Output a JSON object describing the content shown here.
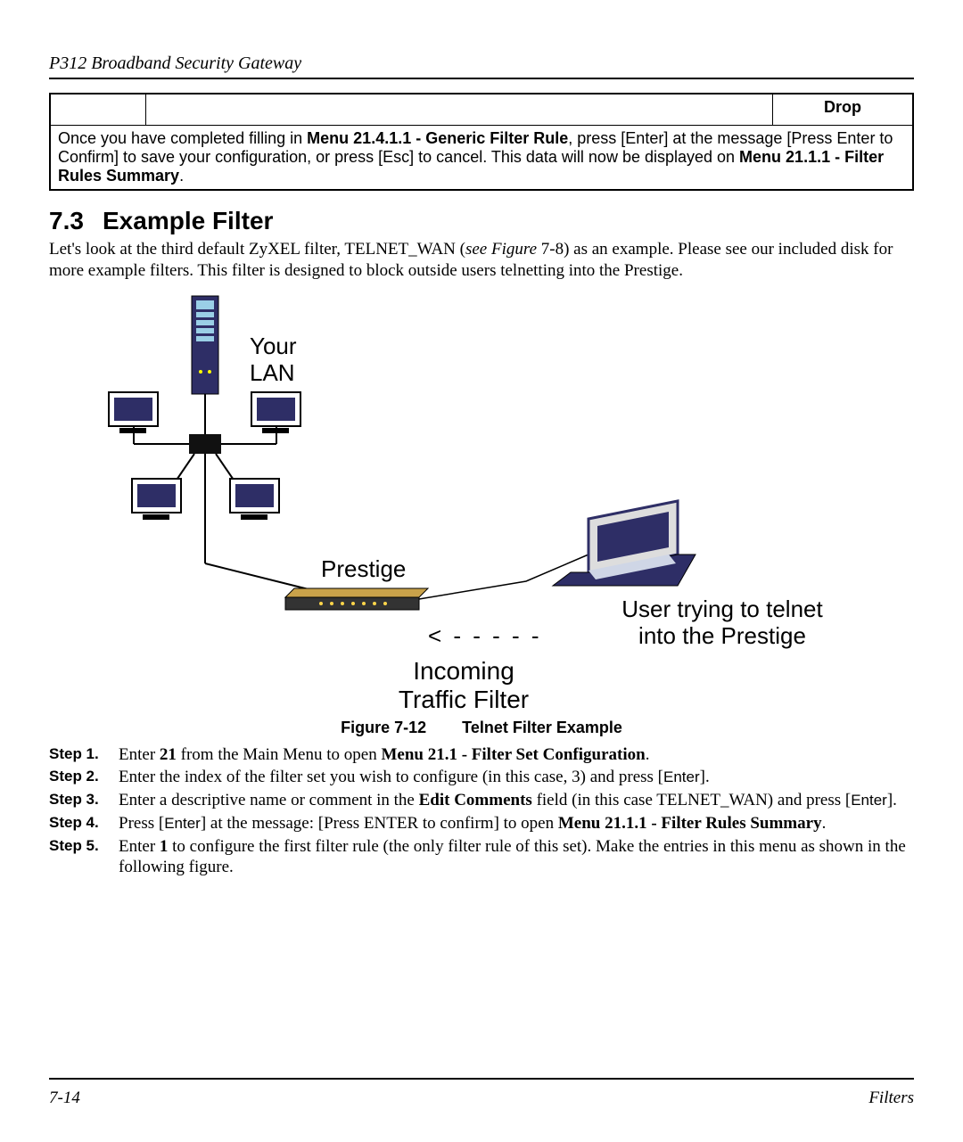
{
  "header": {
    "running": "P312  Broadband Security Gateway"
  },
  "table": {
    "drop_label": "Drop",
    "note_prefix": "Once you have completed filling in ",
    "note_bold1": "Menu 21.4.1.1 - Generic Filter Rule",
    "note_mid": ", press [Enter] at the message [Press Enter to Confirm] to save your configuration, or press [Esc] to cancel. This data will now be displayed on ",
    "note_bold2": "Menu 21.1.1 - Filter Rules Summary",
    "note_end": "."
  },
  "section": {
    "number": "7.3",
    "title": "Example Filter",
    "para_a": "Let's look at the third default ZyXEL filter, TELNET_WAN (",
    "para_italic": "see Figure ",
    "para_b": "7-8) as an example. Please see our included disk for more example filters. This filter is designed to block outside users telnetting into the Prestige."
  },
  "diagram": {
    "lan_label_1": "Your",
    "lan_label_2": "LAN",
    "prestige_label": "Prestige",
    "incoming_1": "Incoming",
    "incoming_2": "Traffic Filter",
    "arrow": "< - - - - -",
    "user_line1": "User trying to telnet",
    "user_line2": "into the Prestige"
  },
  "figure_caption": {
    "label": "Figure 7-12",
    "title": "Telnet Filter Example"
  },
  "steps": [
    {
      "label": "Step 1.",
      "parts": [
        {
          "t": "Enter "
        },
        {
          "t": "21",
          "b": true
        },
        {
          "t": " from the Main Menu to open "
        },
        {
          "t": "Menu 21.1 - Filter Set Configuration",
          "b": true
        },
        {
          "t": "."
        }
      ]
    },
    {
      "label": "Step 2.",
      "parts": [
        {
          "t": "Enter the index of the filter set you wish to configure (in this case, 3) and press ["
        },
        {
          "t": "Enter",
          "sans": true
        },
        {
          "t": "]."
        }
      ]
    },
    {
      "label": "Step 3.",
      "parts": [
        {
          "t": "Enter a descriptive name or comment in the "
        },
        {
          "t": "Edit Comments",
          "b": true
        },
        {
          "t": " field (in this case TELNET_WAN) and press ["
        },
        {
          "t": "Enter",
          "sans": true
        },
        {
          "t": "]."
        }
      ]
    },
    {
      "label": "Step 4.",
      "parts": [
        {
          "t": "Press ["
        },
        {
          "t": "Enter",
          "sans": true
        },
        {
          "t": "] at the message: [Press ENTER to confirm] to open "
        },
        {
          "t": "Menu 21.1.1 - Filter Rules Summary",
          "b": true
        },
        {
          "t": "."
        }
      ]
    },
    {
      "label": "Step 5.",
      "parts": [
        {
          "t": "Enter "
        },
        {
          "t": "1",
          "b": true
        },
        {
          "t": " to configure the first filter rule (the only filter rule of this set). Make the entries in this menu as shown in the following figure."
        }
      ]
    }
  ],
  "footer": {
    "page": "7-14",
    "section": "Filters"
  }
}
